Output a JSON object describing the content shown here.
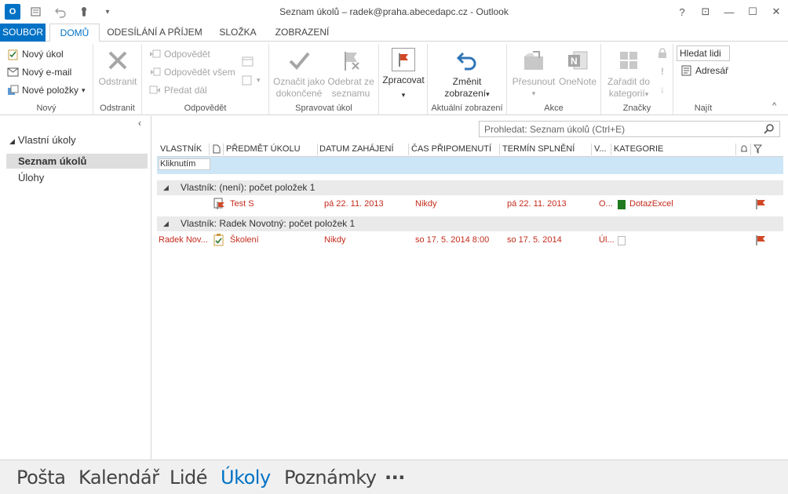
{
  "window": {
    "title": "Seznam úkolů – radek@praha.abecedapc.cz - Outlook",
    "app_badge": "O",
    "help": "?",
    "restore_ribbon": "⊡",
    "minimize": "—",
    "maximize": "☐",
    "close": "✕"
  },
  "ribbon_tabs": {
    "file": "SOUBOR",
    "home": "DOMŮ",
    "send_receive": "ODESÍLÁNÍ A PŘÍJEM",
    "folder": "SLOŽKA",
    "view": "ZOBRAZENÍ"
  },
  "ribbon": {
    "new": {
      "new_task": "Nový úkol",
      "new_email": "Nový e-mail",
      "new_items": "Nové položky",
      "label": "Nový"
    },
    "delete": {
      "delete": "Odstranit",
      "label": "Odstranit"
    },
    "respond": {
      "reply": "Odpovědět",
      "reply_all": "Odpovědět všem",
      "forward": "Předat dál",
      "label": "Odpovědět"
    },
    "manage": {
      "mark_complete_1": "Označit jako",
      "mark_complete_2": "dokončené",
      "remove_list_1": "Odebrat ze",
      "remove_list_2": "seznamu",
      "label": "Spravovat úkol"
    },
    "followup": {
      "process": "Zpracovat"
    },
    "current_view": {
      "change_view_1": "Změnit",
      "change_view_2": "zobrazení",
      "label": "Aktuální zobrazení"
    },
    "actions": {
      "move": "Přesunout",
      "onenote": "OneNote",
      "label": "Akce"
    },
    "tags": {
      "categorize_1": "Zařadit do",
      "categorize_2": "kategorií",
      "label": "Značky"
    },
    "find": {
      "search_people": "Hledat lidi",
      "address_book": "Adresář",
      "label": "Najít"
    }
  },
  "navpane": {
    "collapse": "‹",
    "root": "Vlastní úkoly",
    "items": [
      {
        "label": "Seznam úkolů"
      },
      {
        "label": "Úlohy"
      }
    ]
  },
  "search": {
    "placeholder": "Prohledat: Seznam úkolů (Ctrl+E)"
  },
  "columns": {
    "owner": "VLASTNÍK",
    "subject": "PŘEDMĚT ÚKOLU",
    "start": "DATUM ZAHÁJENÍ",
    "reminder": "ČAS PŘIPOMENUTÍ",
    "due": "TERMÍN SPLNĚNÍ",
    "in_folder": "V...",
    "category": "KATEGORIE"
  },
  "new_item_row": {
    "placeholder": "Kliknutím p..."
  },
  "groups": [
    {
      "header": "Vlastník: (není): počet položek 1",
      "row": {
        "owner": "",
        "subject": "Test S",
        "start": "pá 22. 11. 2013",
        "reminder": "Nikdy",
        "due": "pá 22. 11. 2013",
        "in_folder": "O...",
        "category": "DotazExcel",
        "category_color": "#1f7a1f"
      }
    },
    {
      "header": "Vlastník: Radek Novotný: počet položek 1",
      "row": {
        "owner": "Radek Nov...",
        "subject": "Školení",
        "start": "Nikdy",
        "reminder": "so 17. 5. 2014 8:00",
        "due": "so 17. 5. 2014",
        "in_folder": "Úl...",
        "category": "",
        "category_color": "#ffffff"
      }
    }
  ],
  "bottom_nav": {
    "mail": "Pošta",
    "calendar": "Kalendář",
    "people": "Lidé",
    "tasks": "Úkoly",
    "notes": "Poznámky",
    "more": "···"
  },
  "colors": {
    "accent": "#0072c6",
    "overdue_text": "#c42b1c",
    "flag": "#d24726"
  }
}
